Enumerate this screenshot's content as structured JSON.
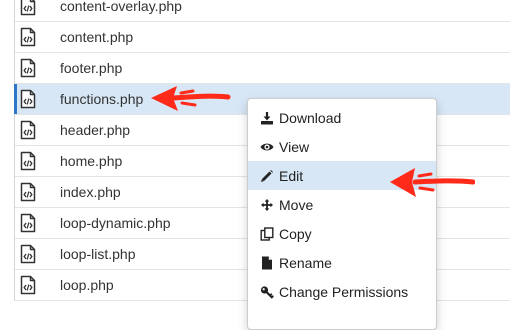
{
  "files": [
    {
      "name": "content-overlay.php",
      "selected": false
    },
    {
      "name": "content.php",
      "selected": false
    },
    {
      "name": "footer.php",
      "selected": false
    },
    {
      "name": "functions.php",
      "selected": true
    },
    {
      "name": "header.php",
      "selected": false
    },
    {
      "name": "home.php",
      "selected": false
    },
    {
      "name": "index.php",
      "selected": false
    },
    {
      "name": "loop-dynamic.php",
      "selected": false
    },
    {
      "name": "loop-list.php",
      "selected": false
    },
    {
      "name": "loop.php",
      "selected": false
    }
  ],
  "context_menu": {
    "items": [
      {
        "label": "Download",
        "icon": "download-icon",
        "highlighted": false
      },
      {
        "label": "View",
        "icon": "eye-icon",
        "highlighted": false
      },
      {
        "label": "Edit",
        "icon": "pencil-icon",
        "highlighted": true
      },
      {
        "label": "Move",
        "icon": "move-icon",
        "highlighted": false
      },
      {
        "label": "Copy",
        "icon": "copy-icon",
        "highlighted": false
      },
      {
        "label": "Rename",
        "icon": "file-icon",
        "highlighted": false
      },
      {
        "label": "Change Permissions",
        "icon": "key-icon",
        "highlighted": false
      }
    ]
  },
  "colors": {
    "selection": "#d7e7f5",
    "annotation_arrow": "#ff2a1a",
    "icon": "#333333"
  }
}
